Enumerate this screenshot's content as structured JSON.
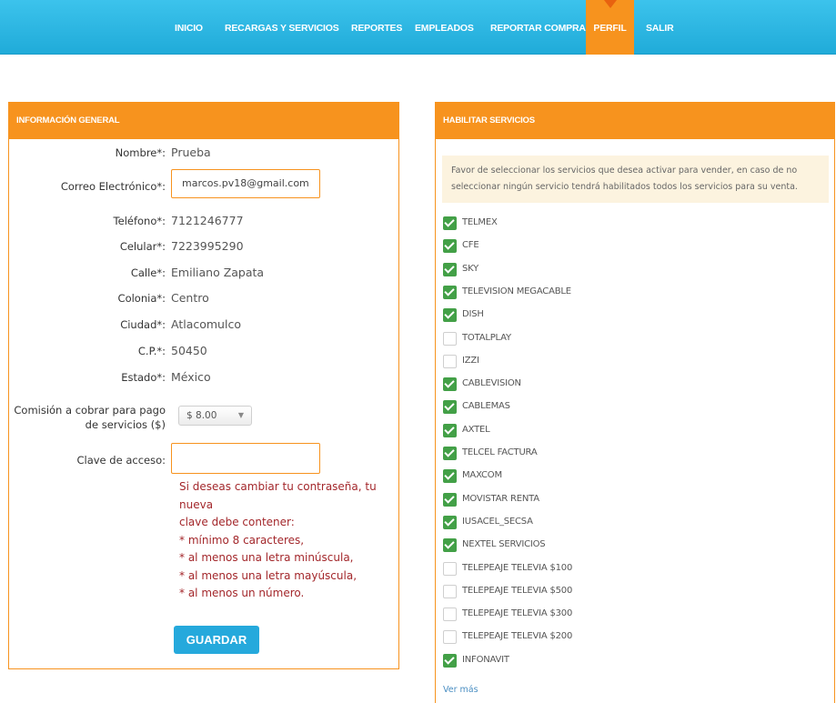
{
  "nav": {
    "items": [
      "INICIO",
      "RECARGAS Y SERVICIOS",
      "REPORTES",
      "EMPLEADOS",
      "REPORTAR COMPRA",
      "PERFIL",
      "SALIR"
    ],
    "active": "PERFIL"
  },
  "general": {
    "title": "INFORMACIÓN GENERAL",
    "nombre_label": "Nombre*:",
    "nombre_value": "Prueba",
    "correo_label": "Correo Electrónico*:",
    "correo_value": "marcos.pv18@gmail.com",
    "telefono_label": "Teléfono*:",
    "telefono_value": "7121246777",
    "celular_label": "Celular*:",
    "celular_value": "7223995290",
    "calle_label": "Calle*:",
    "calle_value": "Emiliano Zapata",
    "colonia_label": "Colonia*:",
    "colonia_value": "Centro",
    "ciudad_label": "Ciudad*:",
    "ciudad_value": "Atlacomulco",
    "cp_label": "C.P.*:",
    "cp_value": "50450",
    "estado_label": "Estado*:",
    "estado_value": "México",
    "comision_label_1": "Comisión a cobrar para pago",
    "comision_label_2": "de servicios ($)",
    "comision_value": "$ 8.00",
    "clave_label": "Clave de acceso:",
    "clave_value": "",
    "hint_lines": [
      "Si deseas cambiar tu contraseña, tu nueva",
      "clave debe contener:",
      "* mínimo 8 caracteres,",
      "* al menos una letra minúscula,",
      "* al menos una letra mayúscula,",
      "* al menos un número."
    ],
    "save_label": "GUARDAR"
  },
  "services": {
    "title": "HABILITAR SERVICIOS",
    "notice_1": "Favor de seleccionar los servicios que desea activar para vender, en caso de no",
    "notice_2": "seleccionar ningún servicio tendrá habilitados todos los servicios para su venta.",
    "items": [
      {
        "label": "TELMEX",
        "checked": true
      },
      {
        "label": "CFE",
        "checked": true
      },
      {
        "label": "SKY",
        "checked": true
      },
      {
        "label": "TELEVISION MEGACABLE",
        "checked": true
      },
      {
        "label": "DISH",
        "checked": true
      },
      {
        "label": "TOTALPLAY",
        "checked": false
      },
      {
        "label": "IZZI",
        "checked": false
      },
      {
        "label": "CABLEVISION",
        "checked": true
      },
      {
        "label": "CABLEMAS",
        "checked": true
      },
      {
        "label": "AXTEL",
        "checked": true
      },
      {
        "label": "TELCEL FACTURA",
        "checked": true
      },
      {
        "label": "MAXCOM",
        "checked": true
      },
      {
        "label": "MOVISTAR RENTA",
        "checked": true
      },
      {
        "label": "IUSACEL_SECSA",
        "checked": true
      },
      {
        "label": "NEXTEL SERVICIOS",
        "checked": true
      },
      {
        "label": "TELEPEAJE TELEVIA $100",
        "checked": false
      },
      {
        "label": "TELEPEAJE TELEVIA $500",
        "checked": false
      },
      {
        "label": "TELEPEAJE TELEVIA $300",
        "checked": false
      },
      {
        "label": "TELEPEAJE TELEVIA $200",
        "checked": false
      },
      {
        "label": "INFONAVIT",
        "checked": true
      }
    ],
    "ver_mas": "Ver más"
  }
}
